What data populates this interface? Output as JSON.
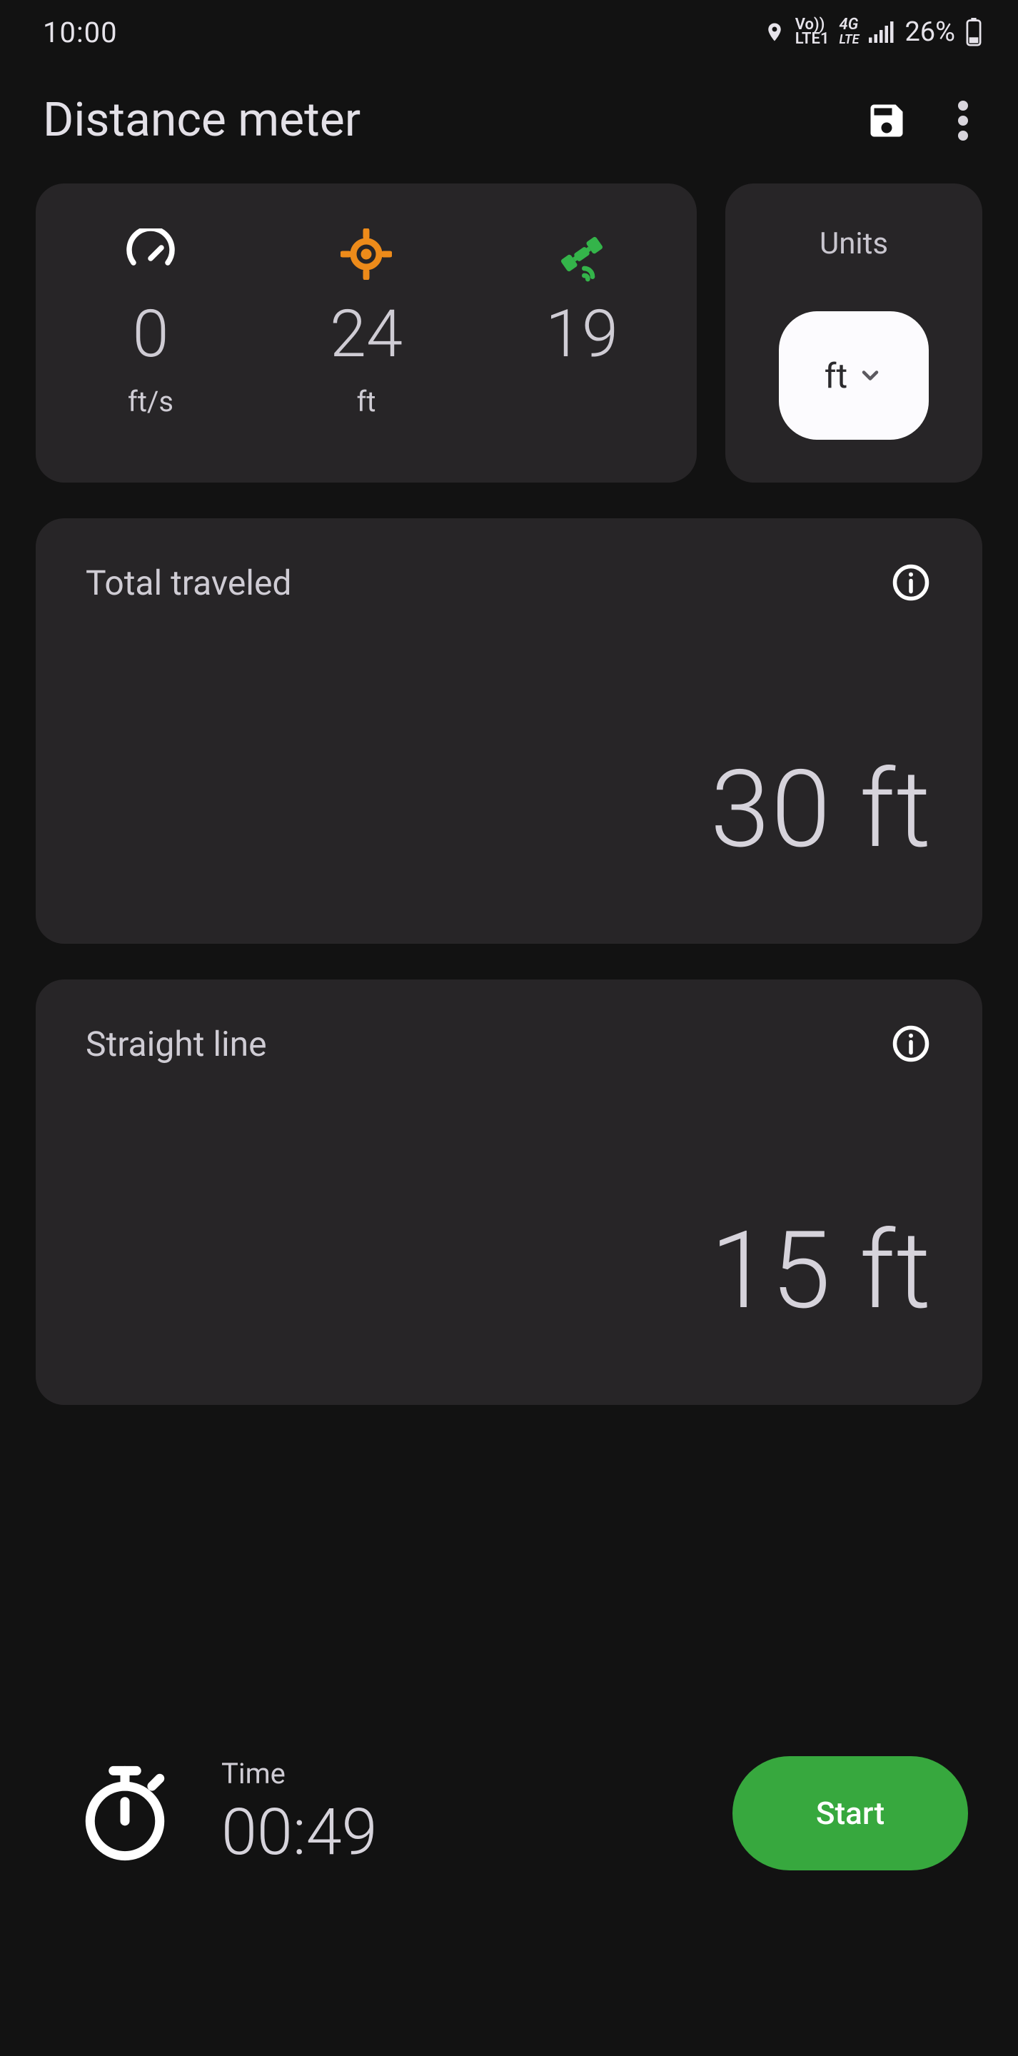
{
  "status": {
    "time": "10:00",
    "network_line1": "Vo))",
    "network_line2": "LTE1",
    "network_4g": "4G",
    "network_lte": "LTE",
    "battery": "26%"
  },
  "app_bar": {
    "title": "Distance meter"
  },
  "stats": {
    "speed": {
      "value": "0",
      "unit": "ft/s"
    },
    "accuracy": {
      "value": "24",
      "unit": "ft"
    },
    "satellites": {
      "value": "19"
    }
  },
  "units": {
    "label": "Units",
    "selected": "ft"
  },
  "metrics": {
    "total_traveled": {
      "title": "Total traveled",
      "value": "30 ft"
    },
    "straight_line": {
      "title": "Straight line",
      "value": "15 ft"
    }
  },
  "timer": {
    "label": "Time",
    "value": "00:49"
  },
  "buttons": {
    "start": "Start"
  }
}
